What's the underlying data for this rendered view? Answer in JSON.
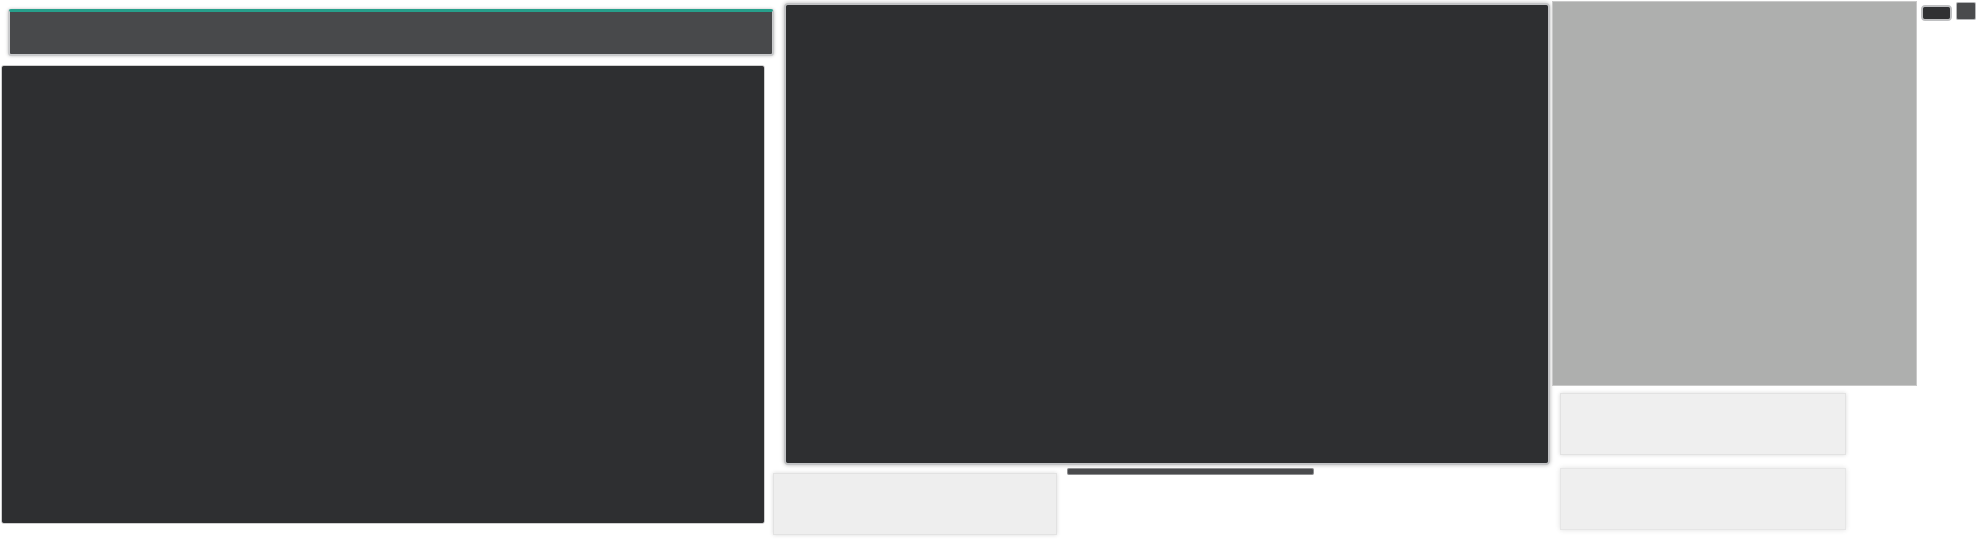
{
  "colors": {
    "page_background": "#ffffff",
    "dark_panel": "#2e2f31",
    "toolbar": "#48494b",
    "accent_teal": "#27a08c",
    "gray_panel": "#aeafae",
    "light_card": "#eeeeee"
  },
  "left": {
    "toolbar_label": "",
    "panel_label": ""
  },
  "center": {
    "panel_label": ""
  },
  "cards": {
    "bottom_left_label": "",
    "right_1_label": "",
    "right_2_label": ""
  },
  "right": {
    "panel_label": ""
  },
  "controls": {
    "button_1_label": "",
    "button_2_label": ""
  }
}
